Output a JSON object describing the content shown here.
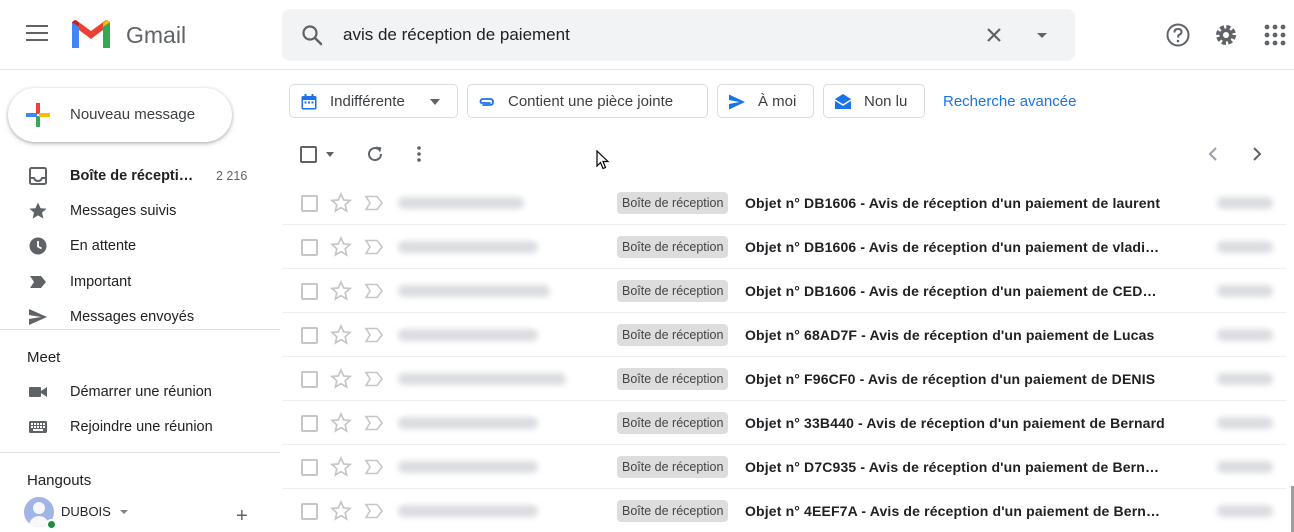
{
  "app": {
    "name": "Gmail"
  },
  "search": {
    "query": "avis de réception de paiement"
  },
  "compose": {
    "label": "Nouveau message"
  },
  "sidebar": {
    "items": [
      {
        "label": "Boîte de récepti…",
        "count": "2 216",
        "icon": "inbox-icon",
        "bold": true
      },
      {
        "label": "Messages suivis",
        "icon": "star-icon"
      },
      {
        "label": "En attente",
        "icon": "clock-icon"
      },
      {
        "label": "Important",
        "icon": "important-icon"
      },
      {
        "label": "Messages envoyés",
        "icon": "send-icon"
      }
    ]
  },
  "meet": {
    "title": "Meet",
    "items": [
      {
        "label": "Démarrer une réunion",
        "icon": "video-icon"
      },
      {
        "label": "Rejoindre une réunion",
        "icon": "keyboard-icon"
      }
    ]
  },
  "hangouts": {
    "title": "Hangouts",
    "user": "DUBOIS"
  },
  "filters": {
    "chips": [
      {
        "label": "Indifférente",
        "icon": "calendar-icon"
      },
      {
        "label": "Contient une pièce jointe",
        "icon": "attachment-icon"
      },
      {
        "label": "À moi",
        "icon": "send-icon"
      },
      {
        "label": "Non lu",
        "icon": "mail-icon"
      }
    ],
    "advanced": "Recherche avancée"
  },
  "colors": {
    "accent": "#1a73e8",
    "gmail_red": "#ea4335"
  },
  "emails": [
    {
      "label": "Boîte de réception",
      "subject": "Objet n° DB1606 - Avis de réception d'un paiement de laurent"
    },
    {
      "label": "Boîte de réception",
      "subject": "Objet n° DB1606 - Avis de réception d'un paiement de vladimir"
    },
    {
      "label": "Boîte de réception",
      "subject": "Objet n° DB1606 - Avis de réception d'un paiement de CEDRIC"
    },
    {
      "label": "Boîte de réception",
      "subject": "Objet n° 68AD7F - Avis de réception d'un paiement de Lucas"
    },
    {
      "label": "Boîte de réception",
      "subject": "Objet n° F96CF0 - Avis de réception d'un paiement de DENIS"
    },
    {
      "label": "Boîte de réception",
      "subject": "Objet n° 33B440 - Avis de réception d'un paiement de Bernard"
    },
    {
      "label": "Boîte de réception",
      "subject": "Objet n° D7C935 - Avis de réception d'un paiement de Bernard"
    },
    {
      "label": "Boîte de réception",
      "subject": "Objet n° 4EEF7A - Avis de réception d'un paiement de Bernard"
    }
  ]
}
